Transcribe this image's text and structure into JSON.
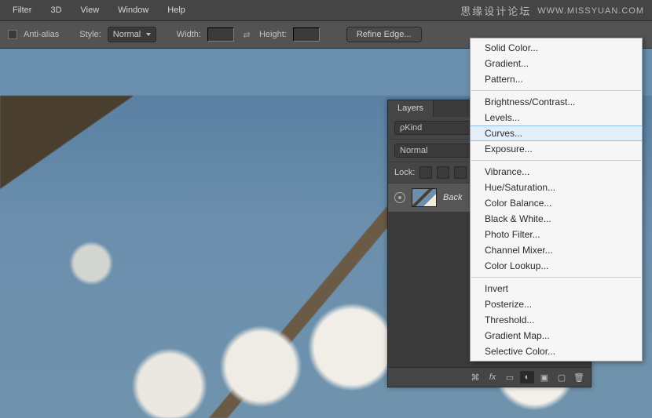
{
  "watermark": {
    "cn": "思缘设计论坛",
    "url": "WWW.MISSYUAN.COM"
  },
  "menubar": [
    "Filter",
    "3D",
    "View",
    "Window",
    "Help"
  ],
  "optionbar": {
    "antialias": "Anti-alias",
    "style_label": "Style:",
    "style_value": "Normal",
    "width_label": "Width:",
    "height_label": "Height:",
    "refine": "Refine Edge..."
  },
  "layers": {
    "tab": "Layers",
    "kind_label": "Kind",
    "blend_value": "Normal",
    "lock_label": "Lock:",
    "entry_name": "Back"
  },
  "popup": {
    "groups": [
      [
        "Solid Color...",
        "Gradient...",
        "Pattern..."
      ],
      [
        "Brightness/Contrast...",
        "Levels...",
        "Curves...",
        "Exposure..."
      ],
      [
        "Vibrance...",
        "Hue/Saturation...",
        "Color Balance...",
        "Black & White...",
        "Photo Filter...",
        "Channel Mixer...",
        "Color Lookup..."
      ],
      [
        "Invert",
        "Posterize...",
        "Threshold...",
        "Gradient Map...",
        "Selective Color..."
      ]
    ],
    "selected": "Curves..."
  }
}
